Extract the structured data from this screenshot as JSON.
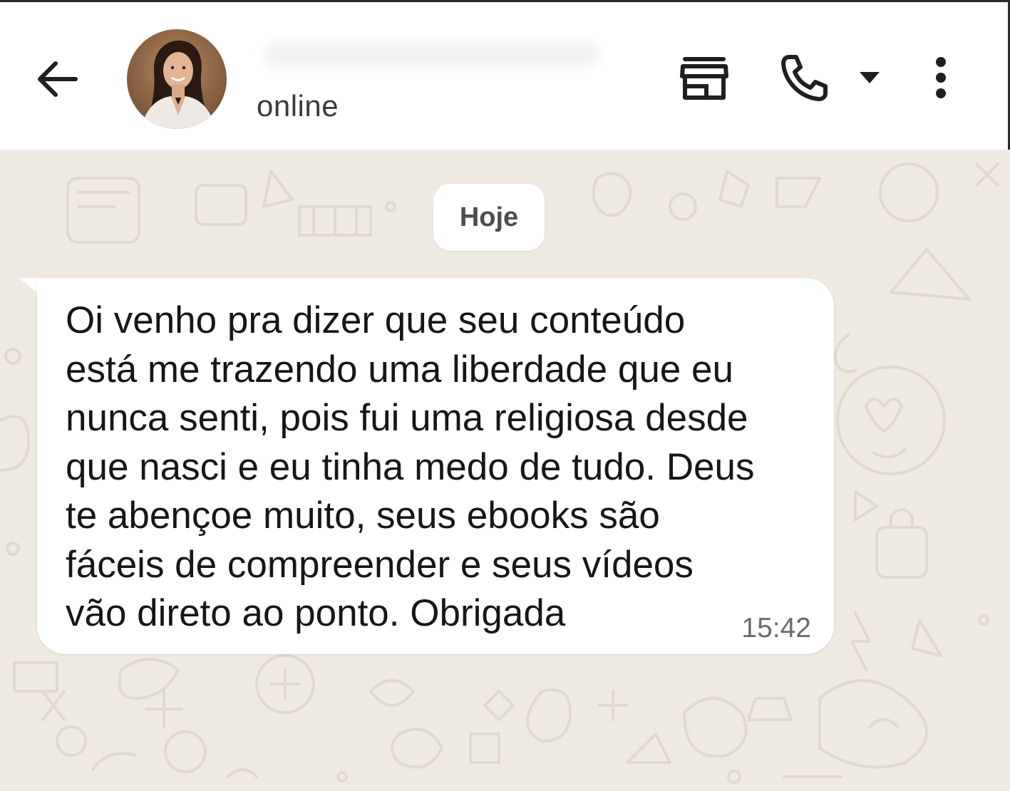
{
  "header": {
    "back_icon": "arrow-left-icon",
    "avatar_description": "contact-avatar",
    "status": "online",
    "icons": {
      "catalog": "storefront-icon",
      "call": "phone-icon",
      "call_options": "caret-down-icon",
      "menu": "more-vertical-icon"
    }
  },
  "chat": {
    "date_label": "Hoje",
    "messages": [
      {
        "direction": "incoming",
        "text": "Oi venho pra dizer que seu conteúdo\nestá me trazendo uma liberdade que eu\nnunca senti, pois fui uma religiosa desde\nque nasci e eu tinha medo de tudo. Deus\nte abençoe muito, seus ebooks são\nfáceis de compreender e seus vídeos\nvão direto ao ponto. Obrigada",
        "time": "15:42"
      }
    ]
  },
  "colors": {
    "header_bg": "#ffffff",
    "chat_bg": "#efeae2",
    "bubble_bg": "#ffffff",
    "icon_color": "#1f1f1f"
  }
}
